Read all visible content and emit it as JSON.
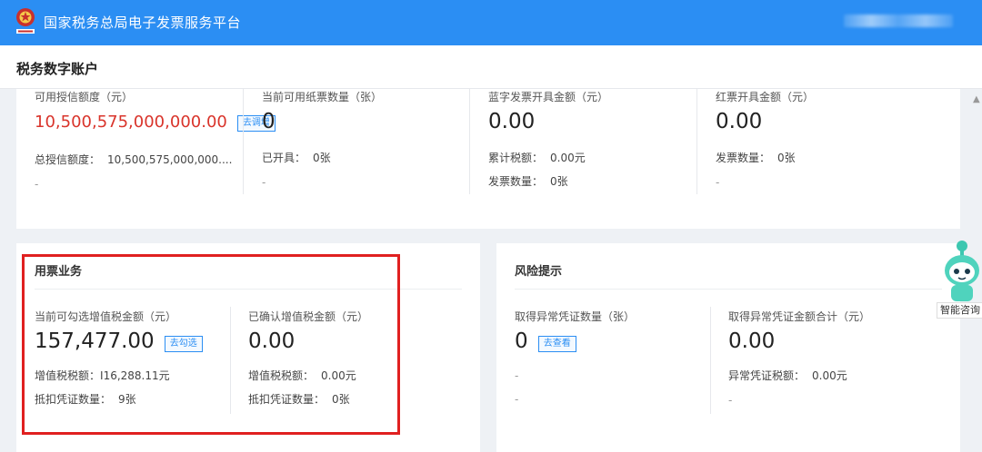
{
  "header": {
    "site_title": "国家税务总局电子发票服务平台",
    "logo_icon": "tax-emblem-icon",
    "brand_color": "#2b8ef3"
  },
  "page": {
    "title": "税务数字账户"
  },
  "summary": [
    {
      "label": "可用授信额度（元）",
      "value": "10,500,575,000,000.00",
      "action": "去调增",
      "line1_label": "总授信额度：",
      "line1_value": "10,500,575,000,000....",
      "line2": "-"
    },
    {
      "label": "当前可用纸票数量（张）",
      "value": "0",
      "line1_label": "已开具：",
      "line1_value": "0张",
      "line2": "-"
    },
    {
      "label": "蓝字发票开具金额（元）",
      "value": "0.00",
      "line1_label": "累计税额：",
      "line1_value": "0.00元",
      "line2_label": "发票数量：",
      "line2_value": "0张"
    },
    {
      "label": "红票开具金额（元）",
      "value": "0.00",
      "line1_label": "发票数量：",
      "line1_value": "0张",
      "line2": "-"
    }
  ],
  "invoice_business": {
    "title": "用票业务",
    "items": [
      {
        "label": "当前可勾选增值税金额（元）",
        "value": "157,477.00",
        "action": "去勾选",
        "line1_label": "增值税税额：",
        "line1_value": "16,288.11元",
        "line2_label": "抵扣凭证数量：",
        "line2_value": "9张"
      },
      {
        "label": "已确认增值税金额（元）",
        "value": "0.00",
        "line1_label": "增值税税额：",
        "line1_value": "0.00元",
        "line2_label": "抵扣凭证数量：",
        "line2_value": "0张"
      }
    ]
  },
  "risk": {
    "title": "风险提示",
    "items": [
      {
        "label": "取得异常凭证数量（张）",
        "value": "0",
        "action": "去查看",
        "line1": "-",
        "line2": "-"
      },
      {
        "label": "取得异常凭证金额合计（元）",
        "value": "0.00",
        "line1_label": "异常凭证税额：",
        "line1_value": "0.00元",
        "line2": "-"
      }
    ]
  },
  "assistant": {
    "label": "智能咨询",
    "icon": "robot-assistant-icon"
  },
  "colors": {
    "highlight": "#e02020",
    "amount_red": "#d9342b"
  }
}
